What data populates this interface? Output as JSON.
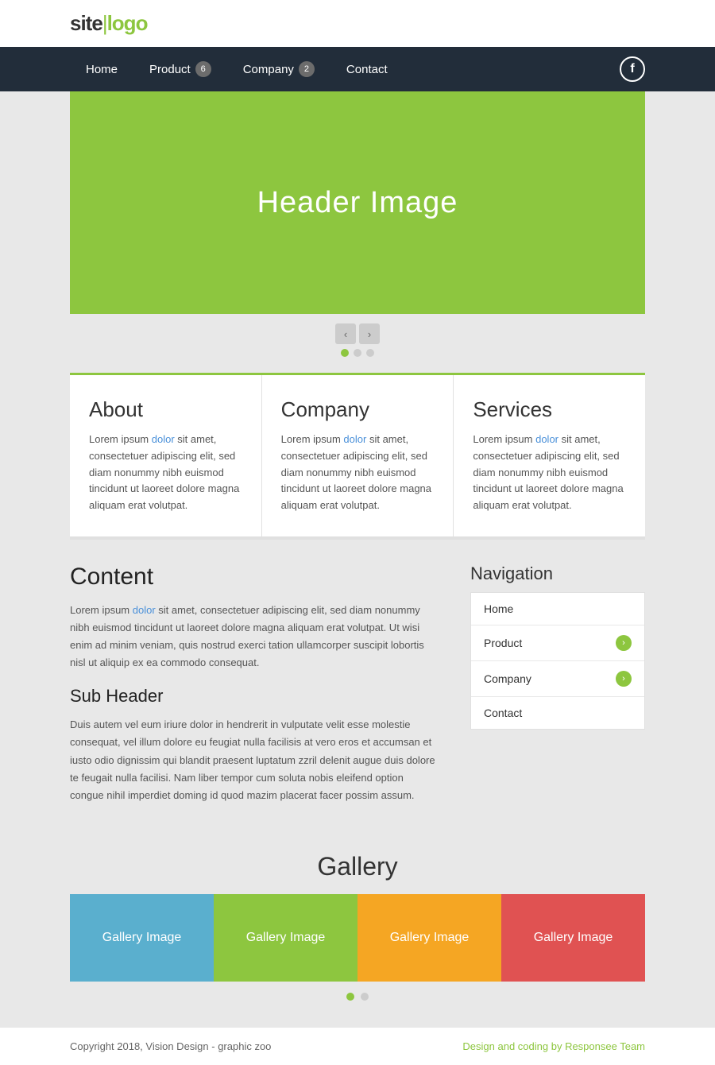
{
  "site": {
    "logo_text": "site",
    "logo_pipe": "|",
    "logo_text2": "logo"
  },
  "nav": {
    "links": [
      {
        "label": "Home",
        "badge": null
      },
      {
        "label": "Product",
        "badge": "6"
      },
      {
        "label": "Company",
        "badge": "2"
      },
      {
        "label": "Contact",
        "badge": null
      }
    ],
    "facebook_icon": "f"
  },
  "hero": {
    "title": "Header Image"
  },
  "slider": {
    "prev_label": "‹",
    "next_label": "›",
    "dots": 3
  },
  "cards": [
    {
      "title": "About",
      "text": "Lorem ipsum dolor sit amet, consectetuer adipiscing elit, sed diam nonummy nibh euismod tincidunt ut laoreet dolore magna aliquam erat volutpat."
    },
    {
      "title": "Company",
      "text": "Lorem ipsum dolor sit amet, consectetuer adipiscing elit, sed diam nonummy nibh euismod tincidunt ut laoreet dolore magna aliquam erat volutpat."
    },
    {
      "title": "Services",
      "text": "Lorem ipsum dolor sit amet, consectetuer adipiscing elit, sed diam nonummy nibh euismod tincidunt ut laoreet dolore magna aliquam erat volutpat."
    }
  ],
  "content": {
    "title": "Content",
    "text": "Lorem ipsum dolor sit amet, consectetuer adipiscing elit, sed diam nonummy nibh euismod tincidunt ut laoreet dolore magna aliquam erat volutpat. Ut wisi enim ad minim veniam, quis nostrud exerci tation ullamcorper suscipit lobortis nisl ut aliquip ex ea commodo consequat.",
    "sub_header": "Sub Header",
    "sub_text": "Duis autem vel eum iriure dolor in hendrerit in vulputate velit esse molestie consequat, vel illum dolore eu feugiat nulla facilisis at vero eros et accumsan et iusto odio dignissim qui blandit praesent luptatum zzril delenit augue duis dolore te feugait nulla facilisi. Nam liber tempor cum soluta nobis eleifend option congue nihil imperdiet doming id quod mazim placerat facer possim assum."
  },
  "sidebar": {
    "title": "Navigation",
    "items": [
      {
        "label": "Home",
        "has_arrow": false
      },
      {
        "label": "Product",
        "has_arrow": true
      },
      {
        "label": "Company",
        "has_arrow": true
      },
      {
        "label": "Contact",
        "has_arrow": false
      }
    ]
  },
  "gallery": {
    "title": "Gallery",
    "items": [
      {
        "label": "Gallery Image",
        "color": "blue"
      },
      {
        "label": "Gallery Image",
        "color": "olive"
      },
      {
        "label": "Gallery Image",
        "color": "yellow"
      },
      {
        "label": "Gallery Image",
        "color": "red"
      }
    ]
  },
  "footer": {
    "copyright": "Copyright 2018, Vision Design - graphic zoo",
    "link_text": "Design and coding by Responsee Team",
    "link_href": "#"
  }
}
